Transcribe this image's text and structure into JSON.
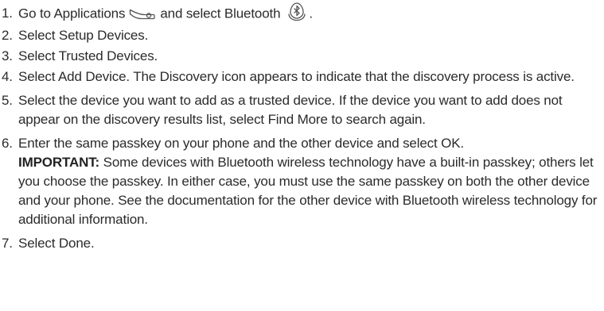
{
  "steps": [
    {
      "number": "1.",
      "before_apps_icon": "Go to Applications",
      "apps_icon": "applications-icon",
      "between_icons": "and select Bluetooth",
      "bluetooth_icon": "bluetooth-icon",
      "after_icon": "."
    },
    {
      "number": "2.",
      "text": "Select Setup Devices."
    },
    {
      "number": "3.",
      "text": "Select Trusted Devices."
    },
    {
      "number": "4.",
      "text": "Select Add Device. The Discovery icon appears to indicate that the discovery process is active."
    },
    {
      "number": "5.",
      "text": "Select the device you want to add as a trusted device. If the device you want to add does not appear on the discovery results list, select Find More to search again."
    },
    {
      "number": "6.",
      "text": "Enter the same passkey on your phone and the other device and select OK.",
      "important_label": "IMPORTANT:",
      "important_text": "Some devices with Bluetooth wireless technology have a built-in passkey; others let you choose the passkey. In either case, you must use the same passkey on both the other device and your phone. See the documentation for the other device with Bluetooth wireless technology for additional information."
    },
    {
      "number": "7.",
      "text": "Select Done."
    }
  ],
  "colors": {
    "text": "#2b2b2b",
    "icon_stroke": "#555555"
  }
}
